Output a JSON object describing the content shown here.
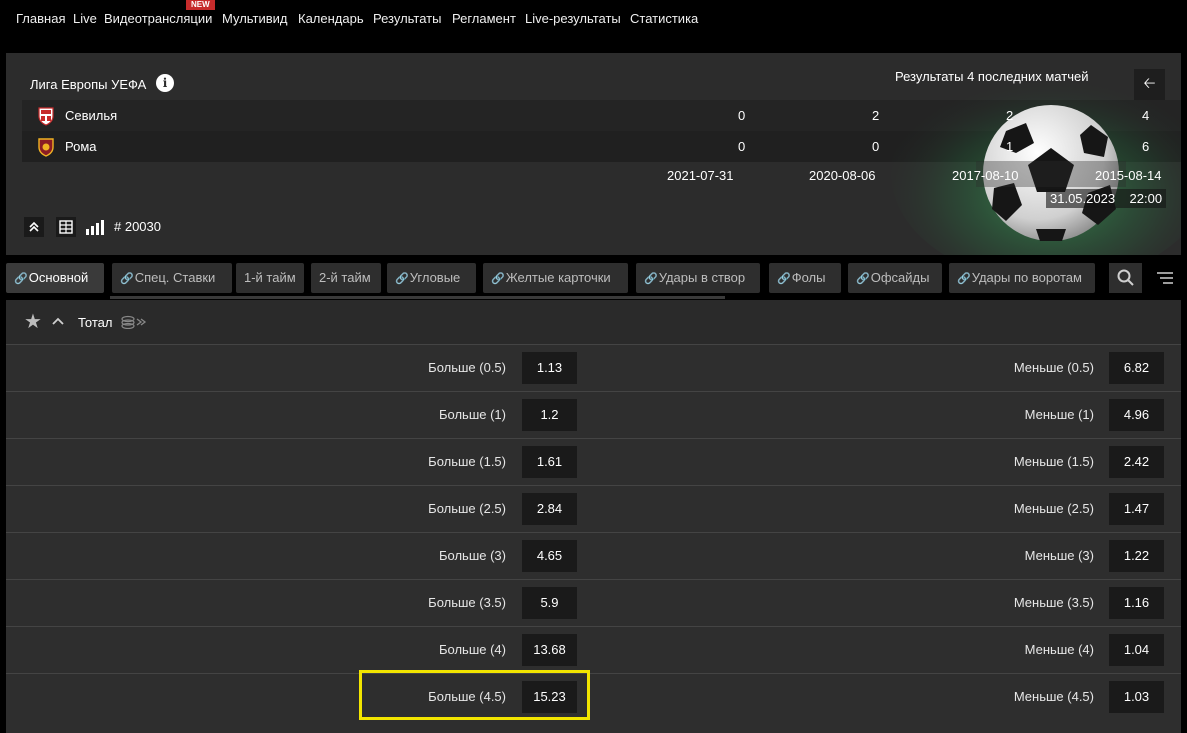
{
  "nav": {
    "items": [
      "Главная",
      "Live",
      "Видеотрансляции",
      "Мультивид",
      "Календарь",
      "Результаты",
      "Регламент",
      "Live-результаты",
      "Статистика"
    ],
    "new_badge": "NEW"
  },
  "match": {
    "league": "Лига Европы УЕФА",
    "results_title": "Результаты 4 последних матчей",
    "back_icon": "back-arrow-icon",
    "teams": [
      {
        "name": "Севилья",
        "scores": [
          "0",
          "2",
          "2",
          "4"
        ]
      },
      {
        "name": "Рома",
        "scores": [
          "0",
          "0",
          "1",
          "6"
        ]
      }
    ],
    "dates": [
      "2021-07-31",
      "2020-08-06",
      "2017-08-10",
      "2015-08-14"
    ],
    "date": "31.05.2023",
    "time": "22:00",
    "match_id": "# 20030"
  },
  "tabs": [
    {
      "label": "Основной",
      "active": true
    },
    {
      "label": "Спец. Ставки"
    },
    {
      "label": "1-й тайм"
    },
    {
      "label": "2-й тайм"
    },
    {
      "label": "Угловые"
    },
    {
      "label": "Желтые карточки"
    },
    {
      "label": "Удары в створ"
    },
    {
      "label": "Фолы"
    },
    {
      "label": "Офсайды"
    },
    {
      "label": "Удары по воротам"
    }
  ],
  "market": {
    "title": "Тотал",
    "rows": [
      {
        "over": "Больше (0.5)",
        "over_odd": "1.13",
        "under": "Меньше (0.5)",
        "under_odd": "6.82"
      },
      {
        "over": "Больше (1)",
        "over_odd": "1.2",
        "under": "Меньше (1)",
        "under_odd": "4.96"
      },
      {
        "over": "Больше (1.5)",
        "over_odd": "1.61",
        "under": "Меньше (1.5)",
        "under_odd": "2.42"
      },
      {
        "over": "Больше (2.5)",
        "over_odd": "2.84",
        "under": "Меньше (2.5)",
        "under_odd": "1.47"
      },
      {
        "over": "Больше (3)",
        "over_odd": "4.65",
        "under": "Меньше (3)",
        "under_odd": "1.22"
      },
      {
        "over": "Больше (3.5)",
        "over_odd": "5.9",
        "under": "Меньше (3.5)",
        "under_odd": "1.16"
      },
      {
        "over": "Больше (4)",
        "over_odd": "13.68",
        "under": "Меньше (4)",
        "under_odd": "1.04"
      },
      {
        "over": "Больше (4.5)",
        "over_odd": "15.23",
        "under": "Меньше (4.5)",
        "under_odd": "1.03"
      }
    ]
  },
  "colors": {
    "highlight": "#f2e500",
    "badge": "#c62b2b",
    "panel": "#2c2c2c"
  }
}
